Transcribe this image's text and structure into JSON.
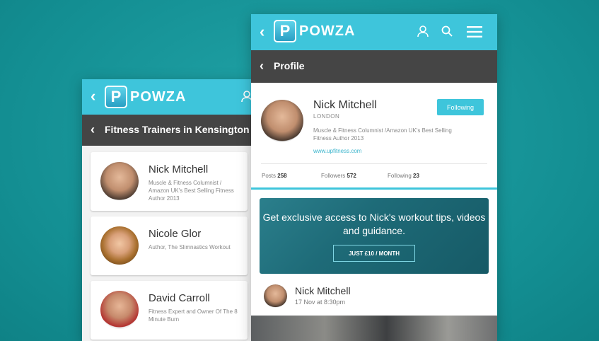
{
  "app": {
    "logo_letter": "P",
    "logo_name": "POWZA",
    "accent": "#3ec5db"
  },
  "back_screen": {
    "title": "Fitness Trainers in Kensington",
    "trainers": [
      {
        "name": "Nick Mitchell",
        "desc": "Muscle & Fitness Columnist / Amazon UK's Best Selling Fitness Author 2013"
      },
      {
        "name": "Nicole Glor",
        "desc": "Author, The Slimnastics Workout"
      },
      {
        "name": "David Carroll",
        "desc": "Fitness Expert and Owner Of The 8 Minute Burn"
      }
    ]
  },
  "front_screen": {
    "title": "Profile",
    "profile": {
      "name": "Nick Mitchell",
      "location": "LONDON",
      "bio": "Muscle & Fitness Columnist /Amazon UK's Best Selling Fitness Author 2013",
      "url": "www.upfitness.com",
      "follow_label": "Following"
    },
    "stats": {
      "posts_label": "Posts",
      "posts": "258",
      "followers_label": "Followers",
      "followers": "572",
      "following_label": "Following",
      "following": "23"
    },
    "promo": {
      "text": "Get exclusive access to Nick's workout tips, videos and guidance.",
      "button": "JUST £10 / MONTH"
    },
    "post": {
      "name": "Nick Mitchell",
      "time": "17 Nov at 8:30pm"
    }
  },
  "icons": [
    "back-chevron-icon",
    "user-icon",
    "search-icon",
    "menu-icon"
  ]
}
